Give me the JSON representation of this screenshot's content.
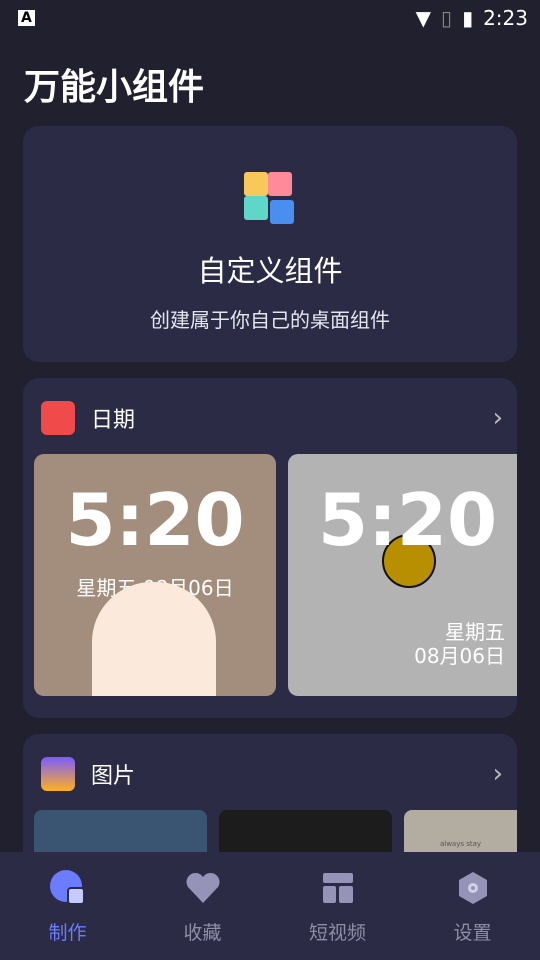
{
  "status": {
    "time": "2:23"
  },
  "app_title": "万能小组件",
  "hero": {
    "title": "自定义组件",
    "subtitle": "创建属于你自己的桌面组件"
  },
  "date_section": {
    "title": "日期",
    "widgets": [
      {
        "time": "5:20",
        "date": "星期五 08月06日"
      },
      {
        "time": "5:20",
        "weekday": "星期五",
        "date": "08月06日"
      }
    ]
  },
  "image_section": {
    "title": "图片",
    "preview_text": "always stay"
  },
  "nav": [
    {
      "label": "制作",
      "icon": "widget-icon",
      "active": true
    },
    {
      "label": "收藏",
      "icon": "heart-icon"
    },
    {
      "label": "短视频",
      "icon": "layout-icon"
    },
    {
      "label": "设置",
      "icon": "gear-icon"
    }
  ],
  "colors": {
    "accent": "#6b7cff",
    "card": "#2b2b45",
    "background": "#20202f"
  }
}
